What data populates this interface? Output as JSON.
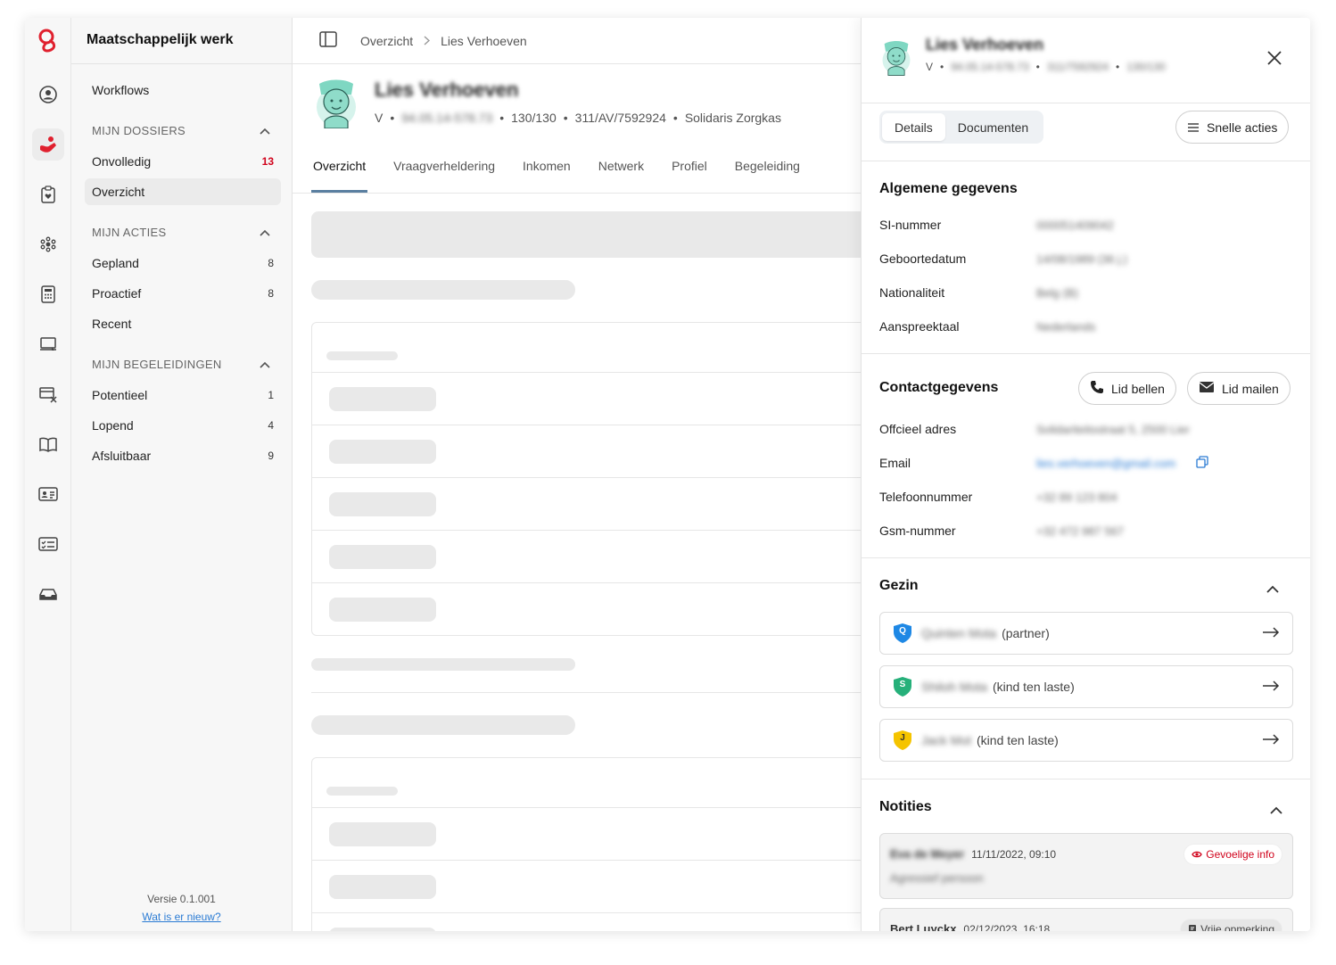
{
  "app": {
    "title": "Maatschappelijk werk"
  },
  "nav": {
    "workflows": "Workflows",
    "sections": [
      {
        "label": "MIJN DOSSIERS",
        "items": [
          {
            "label": "Onvolledig",
            "count": "13"
          },
          {
            "label": "Overzicht",
            "count": ""
          }
        ]
      },
      {
        "label": "MIJN ACTIES",
        "items": [
          {
            "label": "Gepland",
            "count": "8"
          },
          {
            "label": "Proactief",
            "count": "8"
          },
          {
            "label": "Recent",
            "count": ""
          }
        ]
      },
      {
        "label": "MIJN BEGELEIDINGEN",
        "items": [
          {
            "label": "Potentieel",
            "count": "1"
          },
          {
            "label": "Lopend",
            "count": "4"
          },
          {
            "label": "Afsluitbaar",
            "count": "9"
          }
        ]
      }
    ],
    "version": "Versie 0.1.001",
    "whats_new": "Wat is er nieuw?"
  },
  "breadcrumb": {
    "root": "Overzicht",
    "current": "Lies Verhoeven"
  },
  "profile": {
    "name": "Lies Verhoeven",
    "gender": "V",
    "national_id": "94.05.14-578.73",
    "code": "130/130",
    "file_ref": "311/AV/7592924",
    "insurer": "Solidaris Zorgkas"
  },
  "tabs": [
    "Overzicht",
    "Vraagverheldering",
    "Inkomen",
    "Netwerk",
    "Profiel",
    "Begeleiding"
  ],
  "panel": {
    "header": {
      "name": "Lies Verhoeven",
      "gender": "V",
      "national_id": "94.05.14-578.73",
      "file_ref": "311/7592924",
      "code": "130/130"
    },
    "tab_details": "Details",
    "tab_documents": "Documenten",
    "quick_actions": "Snelle acties",
    "general": {
      "title": "Algemene gegevens",
      "rows": [
        {
          "key": "SI-nummer",
          "value": "000051409042"
        },
        {
          "key": "Geboortedatum",
          "value": "14/08/1989 (36 j.)"
        },
        {
          "key": "Nationaliteit",
          "value": "Belg (B)"
        },
        {
          "key": "Aanspreektaal",
          "value": "Nederlands"
        }
      ]
    },
    "contact": {
      "title": "Contactgegevens",
      "call": "Lid bellen",
      "mail": "Lid mailen",
      "rows": [
        {
          "key": "Offcieel adres",
          "value": "Solidariteitsstraat 5, 2500 Lier"
        },
        {
          "key": "Email",
          "value": "lies.verhoeven@gmail.com"
        },
        {
          "key": "Telefoonnummer",
          "value": "+32 89 123 804"
        },
        {
          "key": "Gsm-nummer",
          "value": "+32 472 987 567"
        }
      ]
    },
    "family": {
      "title": "Gezin",
      "members": [
        {
          "initial": "Q",
          "name": "Quinten Mota",
          "role": "(partner)",
          "color": "#1e88e5"
        },
        {
          "initial": "S",
          "name": "Shiloh Mota",
          "role": "(kind ten laste)",
          "color": "#26b07a"
        },
        {
          "initial": "J",
          "name": "Jack Mot",
          "role": "(kind ten laste)",
          "color": "#f5c400"
        }
      ]
    },
    "notes": {
      "title": "Notities",
      "items": [
        {
          "author": "Eva de Meyer",
          "date": "11/11/2022, 09:10",
          "badge": "Gevoelige info",
          "text": "Agressief persoon"
        },
        {
          "author": "Bert Luyckx",
          "date": "02/12/2023, 16:18",
          "badge": "Vrije opmerking",
          "text": ""
        }
      ]
    }
  },
  "colors": {
    "brand": "#e0202e",
    "accent_link": "#2a7bd4",
    "sensitive": "#d0021b"
  }
}
